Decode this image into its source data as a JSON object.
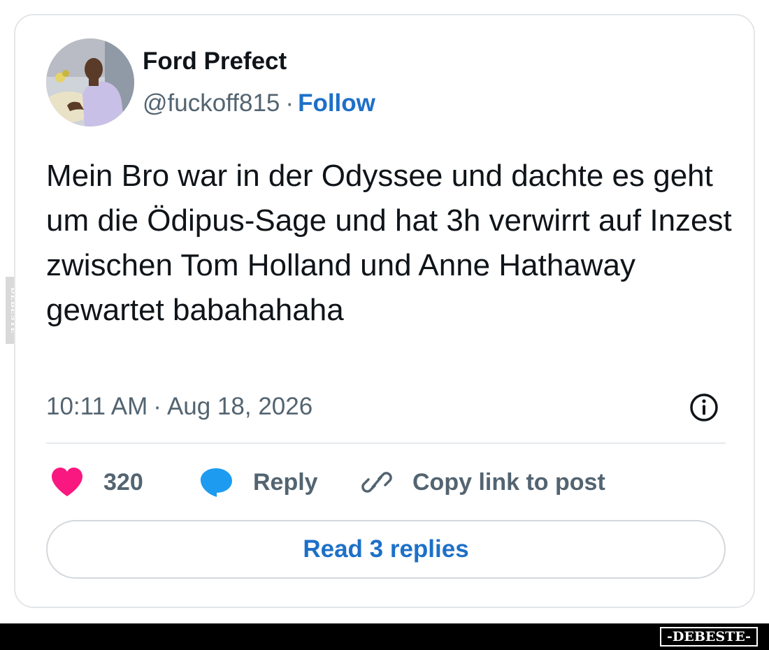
{
  "author": {
    "name": "Ford Prefect",
    "handle": "@fuckoff815",
    "separator": "·",
    "follow_label": "Follow"
  },
  "post": {
    "text": "Mein Bro war in der Odyssee und dachte es geht um die Ödipus-Sage und hat 3h verwirrt auf Inzest zwischen Tom Holland und Anne Hathaway gewartet babahahaha",
    "time": "10:11 AM",
    "separator": "·",
    "date": "Aug 18, 2026"
  },
  "actions": {
    "like_count": "320",
    "reply_label": "Reply",
    "copy_label": "Copy link to post"
  },
  "read_replies_label": "Read 3 replies",
  "watermarks": {
    "side": "DEBESTE",
    "bottom": "-DEBESTE-"
  },
  "colors": {
    "heart": "#f91880",
    "reply": "#1d9bf0",
    "link": "#1d70c8",
    "muted": "#536471",
    "text": "#0f1419"
  },
  "icons": {
    "like": "heart-icon",
    "reply": "speech-bubble-icon",
    "copy": "link-icon",
    "info": "info-icon"
  }
}
